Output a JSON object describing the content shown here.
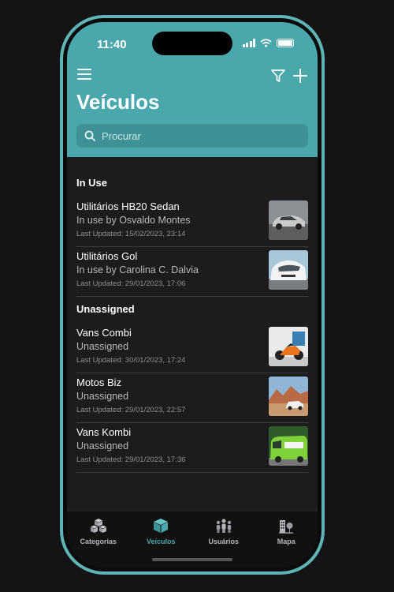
{
  "status": {
    "time": "11:40"
  },
  "header": {
    "title": "Veículos"
  },
  "search": {
    "placeholder": "Procurar"
  },
  "sections": [
    {
      "header": "In Use",
      "items": [
        {
          "title": "Utilitários HB20 Sedan",
          "subtitle": "In use by Osvaldo Montes",
          "updated": "Last Updated: 15/02/2023, 23:14",
          "thumb": "silver-sedan"
        },
        {
          "title": "Utilitários Gol",
          "subtitle": "In use by Carolina C. Dalvia",
          "updated": "Last Updated: 29/01/2023, 17:06",
          "thumb": "white-hatchback"
        }
      ]
    },
    {
      "header": "Unassigned",
      "items": [
        {
          "title": "Vans Combi",
          "subtitle": "Unassigned",
          "updated": "Last Updated: 30/01/2023, 17:24",
          "thumb": "orange-motorcycle"
        },
        {
          "title": "Motos Biz",
          "subtitle": "Unassigned",
          "updated": "Last Updated: 29/01/2023, 22:57",
          "thumb": "suv-desert"
        },
        {
          "title": "Vans Kombi",
          "subtitle": "Unassigned",
          "updated": "Last Updated: 29/01/2023, 17:36",
          "thumb": "green-van"
        }
      ]
    }
  ],
  "tabs": [
    {
      "label": "Categorias",
      "icon": "cubes-icon",
      "active": false
    },
    {
      "label": "Veículos",
      "icon": "cube-icon",
      "active": true
    },
    {
      "label": "Usuários",
      "icon": "users-icon",
      "active": false
    },
    {
      "label": "Mapa",
      "icon": "map-icon",
      "active": false
    }
  ],
  "colors": {
    "accent": "#4aa7ab",
    "frame": "#5fb4b6",
    "background": "#1c1c1f"
  }
}
